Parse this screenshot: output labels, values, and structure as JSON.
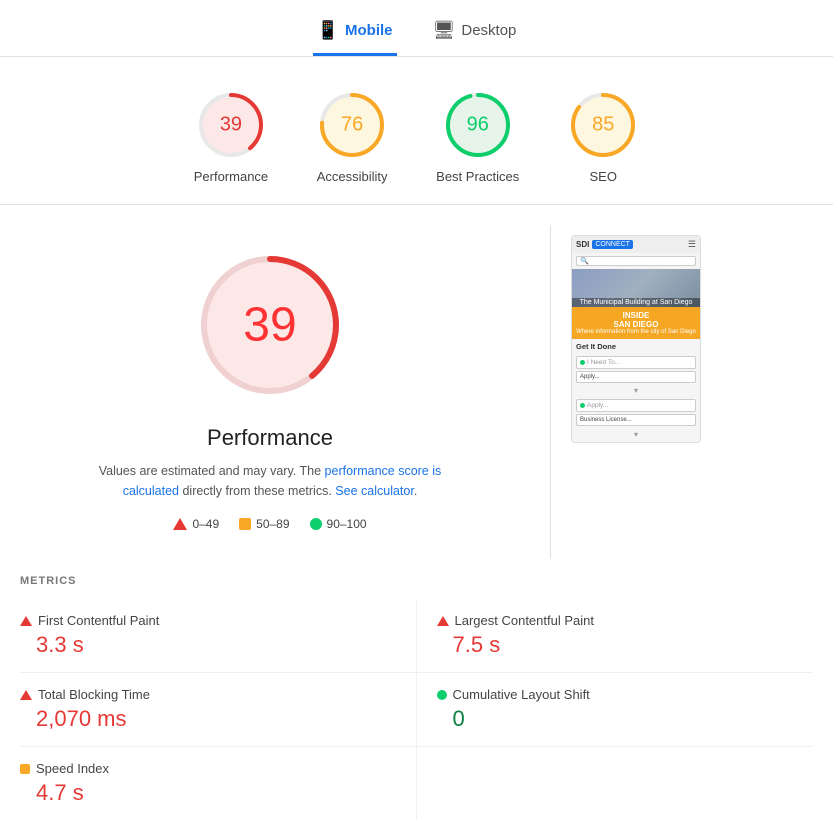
{
  "tabs": [
    {
      "id": "mobile",
      "label": "Mobile",
      "icon": "📱",
      "active": true
    },
    {
      "id": "desktop",
      "label": "Desktop",
      "icon": "🖥",
      "active": false
    }
  ],
  "scores": [
    {
      "id": "performance",
      "value": 39,
      "label": "Performance",
      "color": "#e53935",
      "track_color": "#fce8e6",
      "percent": 39
    },
    {
      "id": "accessibility",
      "value": 76,
      "label": "Accessibility",
      "color": "#f9a825",
      "track_color": "#fef7e0",
      "percent": 76
    },
    {
      "id": "best-practices",
      "value": 96,
      "label": "Best Practices",
      "color": "#0cce6b",
      "track_color": "#e6f4ea",
      "percent": 96
    },
    {
      "id": "seo",
      "value": 85,
      "label": "SEO",
      "color": "#f9a825",
      "track_color": "#fef7e0",
      "percent": 85
    }
  ],
  "performance": {
    "big_score": 39,
    "title": "Performance",
    "desc_part1": "Values are estimated and may vary. The",
    "desc_link1": "performance score is calculated",
    "desc_part2": "directly from these metrics.",
    "desc_link2": "See calculator",
    "desc_end": "."
  },
  "legend": [
    {
      "id": "red",
      "range": "0–49",
      "type": "red"
    },
    {
      "id": "orange",
      "range": "50–89",
      "type": "orange"
    },
    {
      "id": "green",
      "range": "90–100",
      "type": "green"
    }
  ],
  "metrics_title": "METRICS",
  "metrics": [
    {
      "id": "fcp",
      "name": "First Contentful Paint",
      "value": "3.3 s",
      "icon": "red",
      "value_color": "red"
    },
    {
      "id": "lcp",
      "name": "Largest Contentful Paint",
      "value": "7.5 s",
      "icon": "red",
      "value_color": "red"
    },
    {
      "id": "tbt",
      "name": "Total Blocking Time",
      "value": "2,070 ms",
      "icon": "red",
      "value_color": "red"
    },
    {
      "id": "cls",
      "name": "Cumulative Layout Shift",
      "value": "0",
      "icon": "green",
      "value_color": "green"
    },
    {
      "id": "si",
      "name": "Speed Index",
      "value": "4.7 s",
      "icon": "orange",
      "value_color": "red"
    }
  ]
}
